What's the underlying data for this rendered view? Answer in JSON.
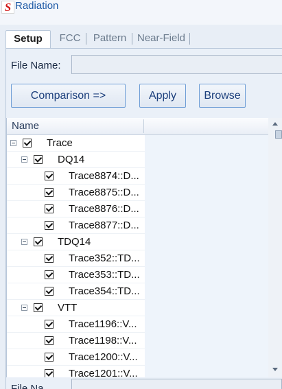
{
  "app": {
    "logo_letter": "S",
    "title": "Radiation"
  },
  "tabs": [
    {
      "label": "Setup",
      "active": true
    },
    {
      "label": "FCC",
      "active": false
    },
    {
      "label": "Pattern",
      "active": false
    },
    {
      "label": "Near-Field",
      "active": false
    }
  ],
  "setup": {
    "file_name_label": "File Name:",
    "file_name_value": "",
    "buttons": {
      "comparison": "Comparison =>",
      "apply": "Apply",
      "browse": "Browse"
    }
  },
  "grid": {
    "column_name": "Name",
    "rows": [
      {
        "label": "Trace",
        "checked": true,
        "expandable": true
      },
      {
        "label": "DQ14",
        "checked": true,
        "expandable": true
      },
      {
        "label": "Trace8874::D...",
        "checked": true,
        "expandable": false
      },
      {
        "label": "Trace8875::D...",
        "checked": true,
        "expandable": false
      },
      {
        "label": "Trace8876::D...",
        "checked": true,
        "expandable": false
      },
      {
        "label": "Trace8877::D...",
        "checked": true,
        "expandable": false
      },
      {
        "label": "TDQ14",
        "checked": true,
        "expandable": true
      },
      {
        "label": "Trace352::TD...",
        "checked": true,
        "expandable": false
      },
      {
        "label": "Trace353::TD...",
        "checked": true,
        "expandable": false
      },
      {
        "label": "Trace354::TD...",
        "checked": true,
        "expandable": false
      },
      {
        "label": "VTT",
        "checked": true,
        "expandable": true
      },
      {
        "label": "Trace1196::V...",
        "checked": true,
        "expandable": false
      },
      {
        "label": "Trace1198::V...",
        "checked": true,
        "expandable": false
      },
      {
        "label": "Trace1200::V...",
        "checked": true,
        "expandable": false
      },
      {
        "label": "Trace1201::V...",
        "checked": true,
        "expandable": false
      }
    ]
  },
  "bottom": {
    "file_name_label": "File Na"
  },
  "colors": {
    "accent": "#1e5aa6",
    "logo_red": "#d21a1a",
    "button_border": "#6f9ed6"
  }
}
